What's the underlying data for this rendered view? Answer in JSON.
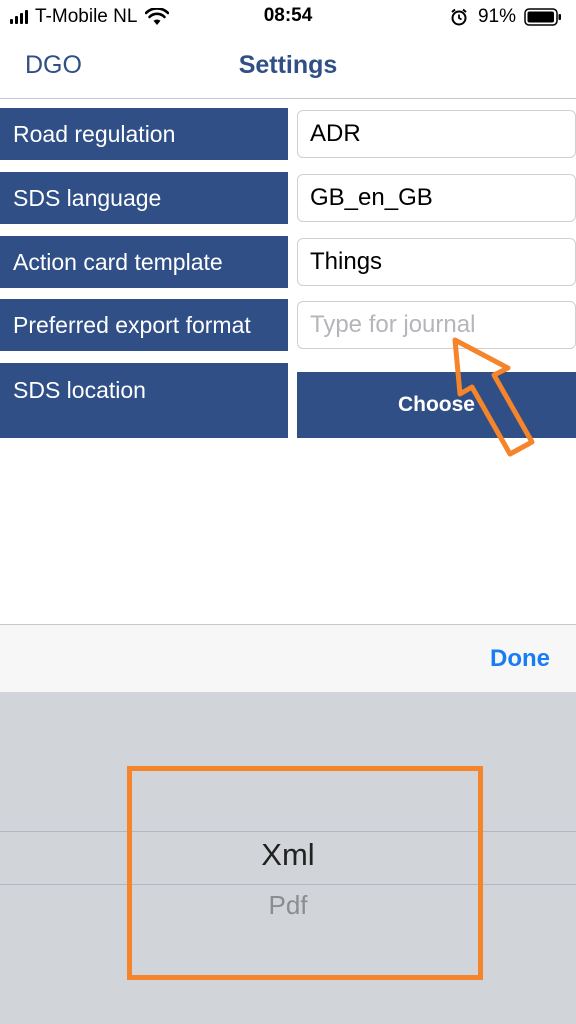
{
  "status_bar": {
    "carrier": "T-Mobile NL",
    "time": "08:54",
    "battery_percent": "91%",
    "icons": [
      "signal-icon",
      "wifi-icon",
      "alarm-icon",
      "battery-icon"
    ]
  },
  "nav": {
    "back_label": "DGO",
    "title": "Settings"
  },
  "settings": {
    "rows": [
      {
        "label": "Road regulation",
        "value": "ADR"
      },
      {
        "label": "SDS language",
        "value": "GB_en_GB"
      },
      {
        "label": "Action card template",
        "value": "Things"
      },
      {
        "label": "Preferred export format",
        "placeholder": "Type for journal"
      },
      {
        "label": "SDS location",
        "button": "Choose"
      }
    ]
  },
  "picker": {
    "done_label": "Done",
    "selected": "Xml",
    "next": "Pdf"
  },
  "colors": {
    "accent_blue": "#2f4f86",
    "done_blue": "#1a7cf5",
    "highlight_orange": "#f5842a",
    "picker_bg": "#d1d4d9"
  }
}
